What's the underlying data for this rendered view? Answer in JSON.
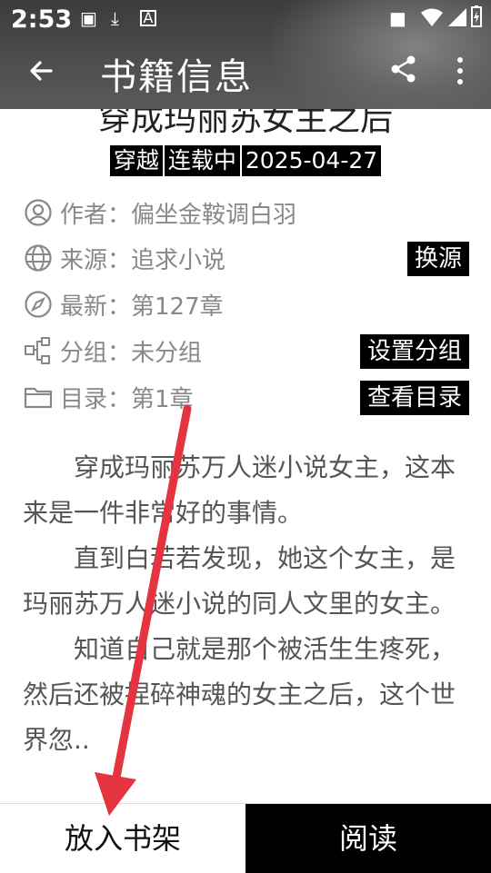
{
  "status_bar": {
    "time": "2:53"
  },
  "toolbar": {
    "title": "书籍信息"
  },
  "book": {
    "title": "穿成玛丽苏女主之后",
    "tags": [
      "穿越",
      "连载中",
      "2025-04-27"
    ],
    "author": "作者：偏坐金鞍调白羽",
    "source": "来源：追求小说",
    "latest": "最新：第127章",
    "group": "分组：未分组",
    "toc": "目录：第1章",
    "intro": [
      "穿成玛丽苏万人迷小说女主，这本来是一件非常好的事情。",
      "直到白若若发现，她这个女主，是玛丽苏万人迷小说的同人文里的女主。",
      "知道自己就是那个被活生生疼死，然后还被捏碎神魂的女主之后，这个世界忽.."
    ]
  },
  "buttons": {
    "change_source": "换源",
    "set_group": "设置分组",
    "view_toc": "查看目录",
    "add_to_shelf": "放入书架",
    "read": "阅读"
  },
  "icons": {
    "back": "arrow-left-icon",
    "share": "share-icon",
    "more": "more-vert-icon"
  },
  "colors": {
    "annotation_arrow": "#e5343f"
  }
}
